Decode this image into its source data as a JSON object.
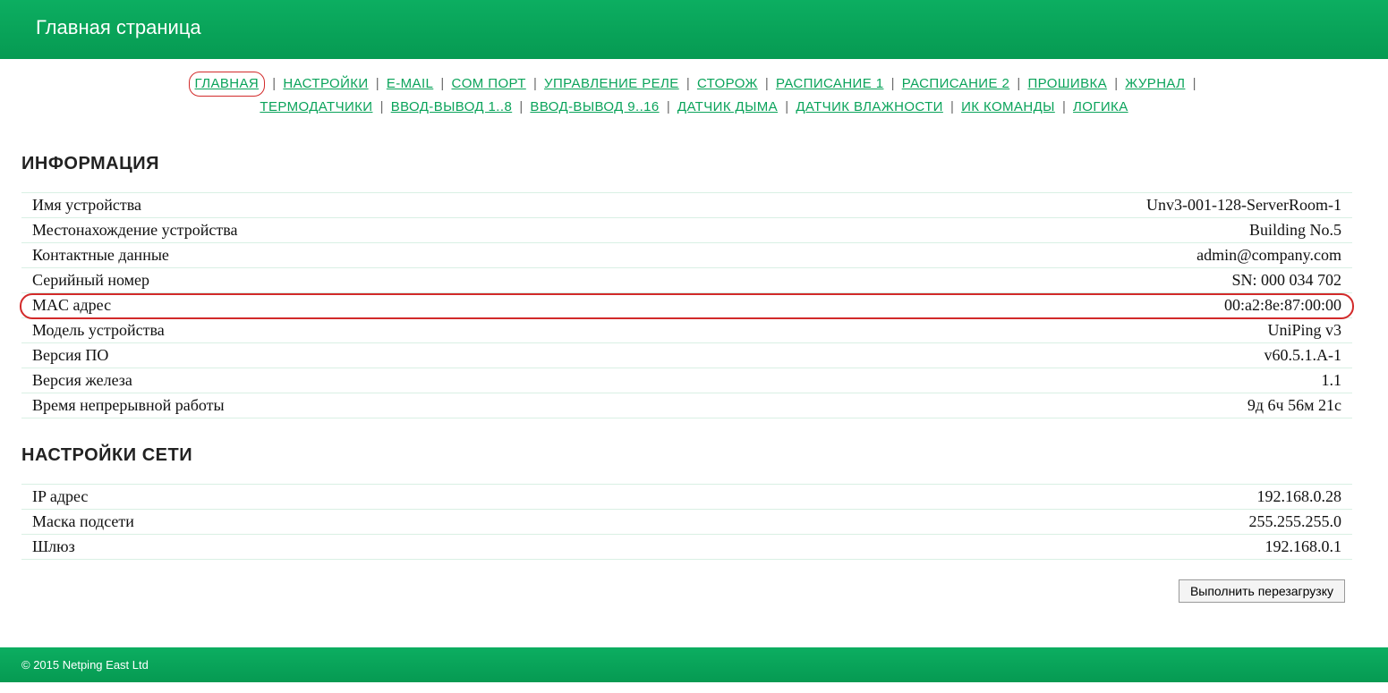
{
  "header": {
    "title": "Главная страница"
  },
  "nav": {
    "items": [
      {
        "label": "ГЛАВНАЯ",
        "highlighted": true
      },
      {
        "label": "НАСТРОЙКИ"
      },
      {
        "label": "E-MAIL"
      },
      {
        "label": "COM ПОРТ"
      },
      {
        "label": "УПРАВЛЕНИЕ РЕЛЕ"
      },
      {
        "label": "СТОРОЖ"
      },
      {
        "label": "РАСПИСАНИЕ 1"
      },
      {
        "label": "РАСПИСАНИЕ 2"
      },
      {
        "label": "ПРОШИВКА"
      },
      {
        "label": "ЖУРНАЛ"
      },
      {
        "label": "ТЕРМОДАТЧИКИ"
      },
      {
        "label": "ВВОД-ВЫВОД 1..8"
      },
      {
        "label": "ВВОД-ВЫВОД 9..16"
      },
      {
        "label": "ДАТЧИК ДЫМА"
      },
      {
        "label": "ДАТЧИК ВЛАЖНОСТИ"
      },
      {
        "label": "ИК КОМАНДЫ"
      },
      {
        "label": "ЛОГИКА"
      }
    ],
    "break_after_index": 9
  },
  "sections": {
    "info": {
      "title": "ИНФОРМАЦИЯ",
      "rows": [
        {
          "label": "Имя устройства",
          "value": "Unv3-001-128-ServerRoom-1"
        },
        {
          "label": "Местонахождение устройства",
          "value": "Building No.5"
        },
        {
          "label": "Контактные данные",
          "value": "admin@company.com"
        },
        {
          "label": "Серийный номер",
          "value": "SN: 000 034 702"
        },
        {
          "label": "MAC адрес",
          "value": "00:a2:8e:87:00:00",
          "highlighted": true
        },
        {
          "label": "Модель устройства",
          "value": "UniPing v3"
        },
        {
          "label": "Версия ПО",
          "value": "v60.5.1.A-1"
        },
        {
          "label": "Версия железа",
          "value": "1.1"
        },
        {
          "label": "Время непрерывной работы",
          "value": "9д 6ч 56м 21с"
        }
      ]
    },
    "net": {
      "title": "НАСТРОЙКИ СЕТИ",
      "rows": [
        {
          "label": "IP адрес",
          "value": "192.168.0.28"
        },
        {
          "label": "Маска подсети",
          "value": "255.255.255.0"
        },
        {
          "label": "Шлюз",
          "value": "192.168.0.1"
        }
      ]
    }
  },
  "buttons": {
    "reload": "Выполнить перезагрузку"
  },
  "footer": {
    "text": "© 2015 Netping East Ltd"
  }
}
